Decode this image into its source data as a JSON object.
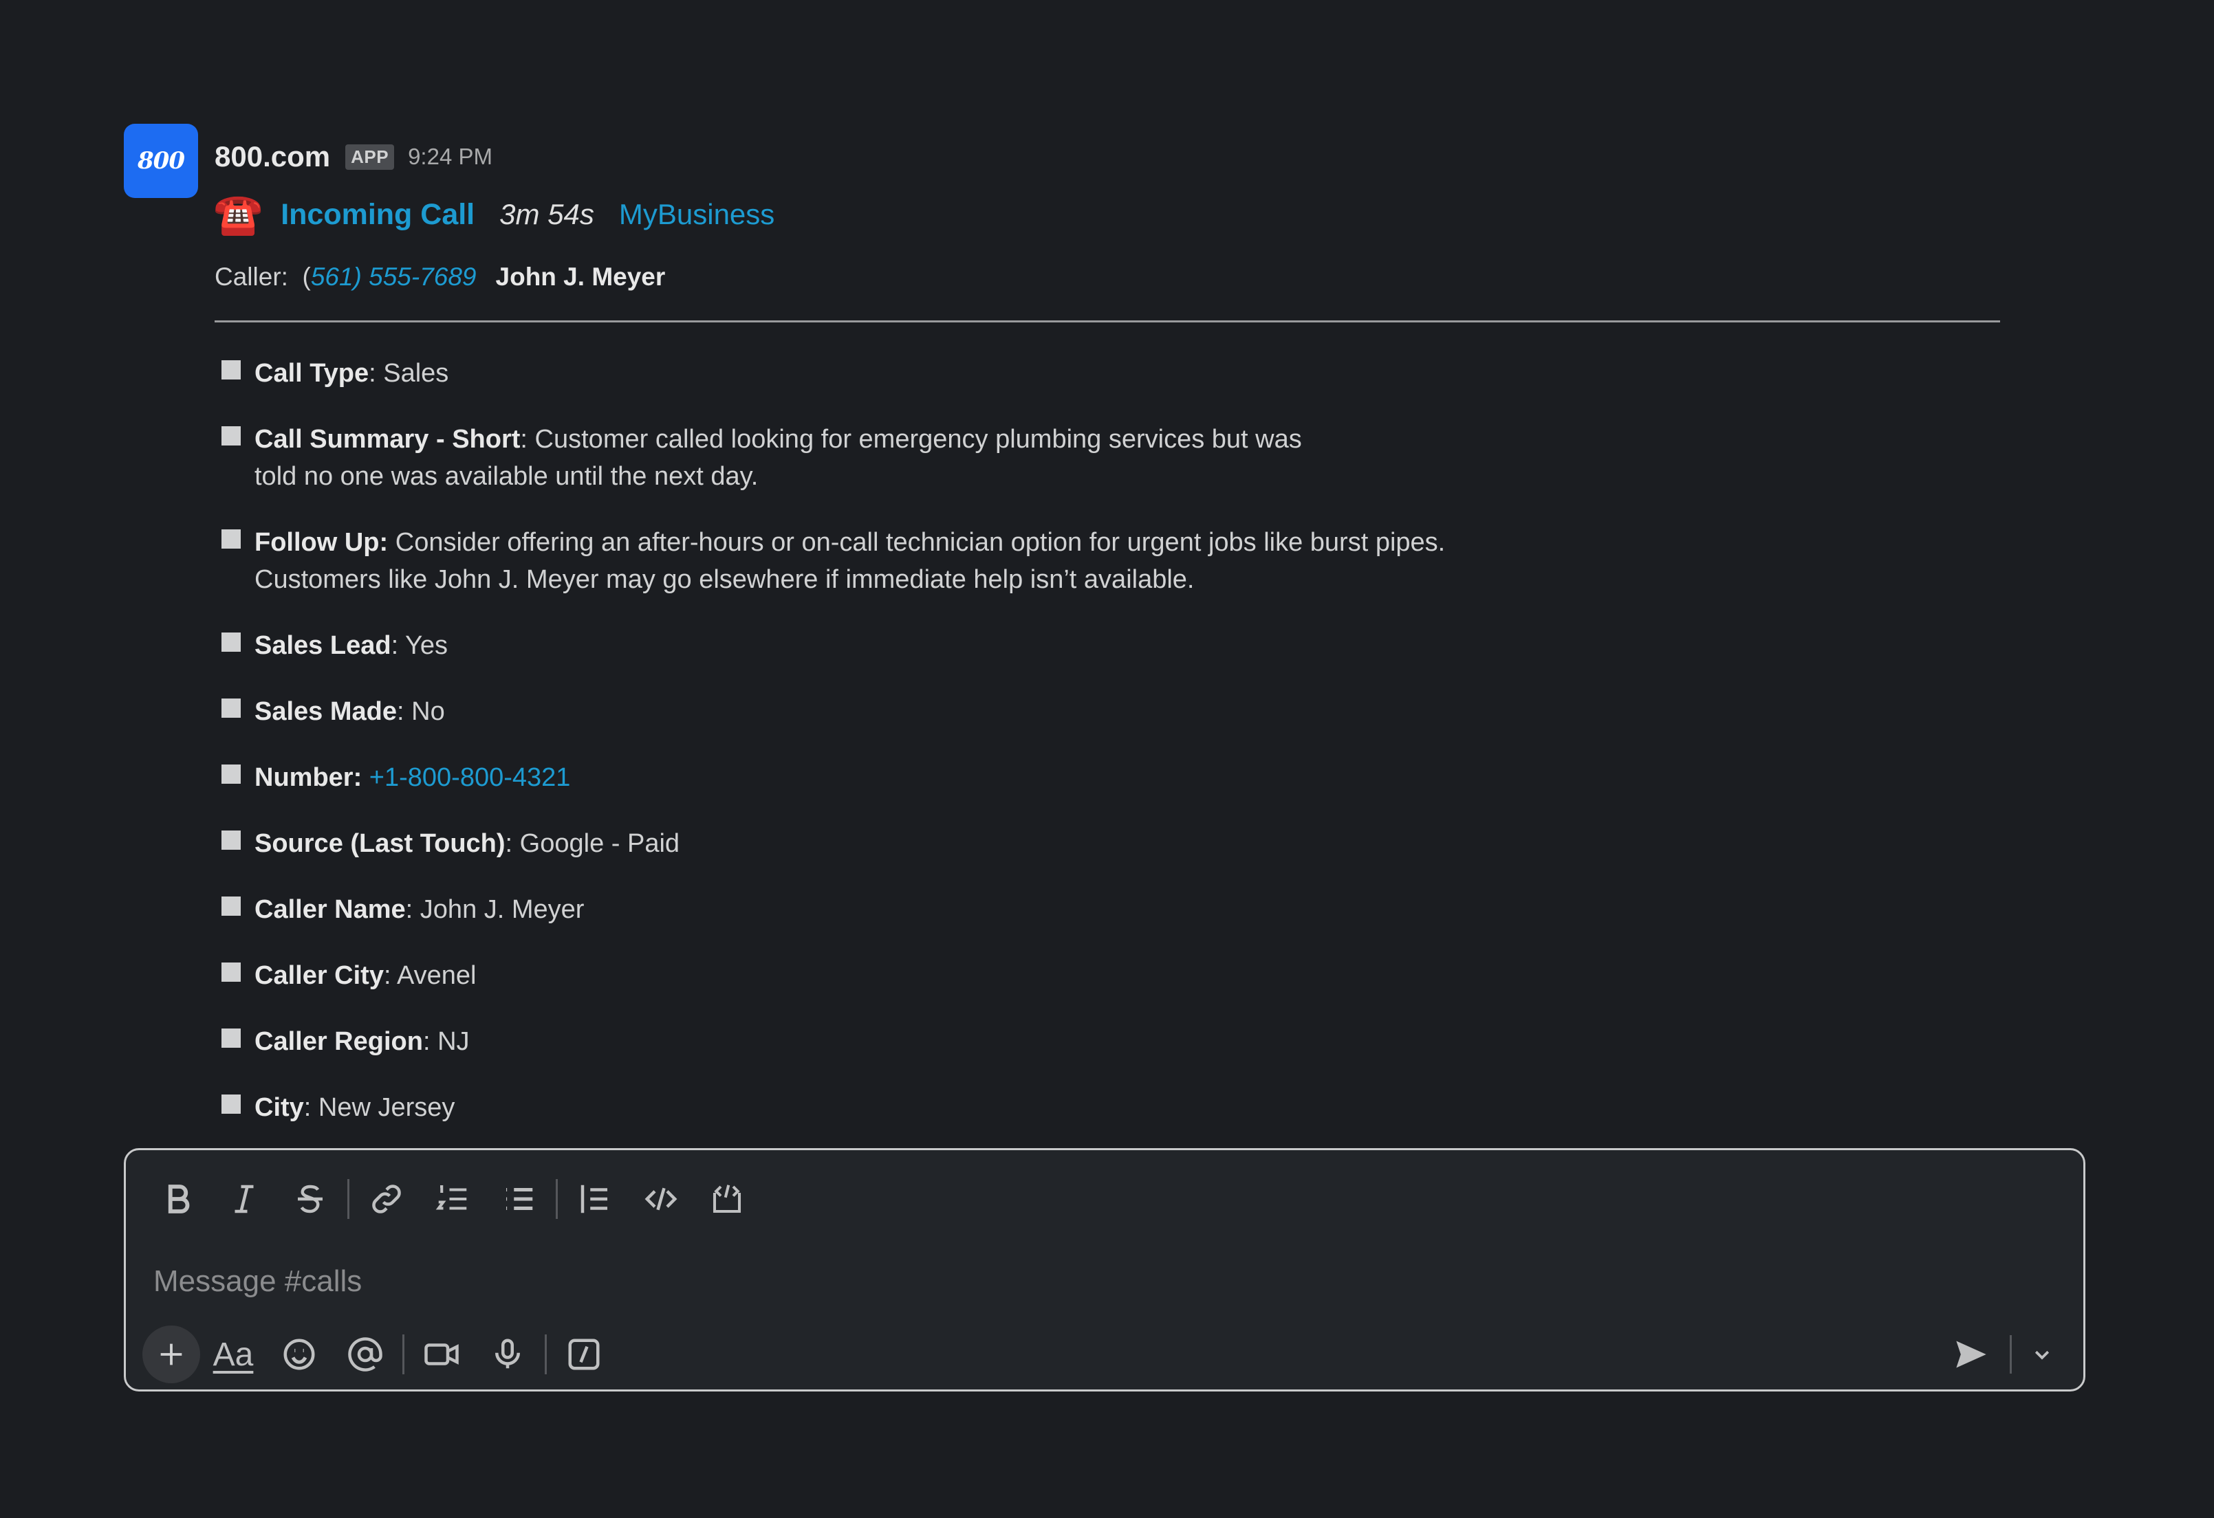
{
  "message": {
    "app_name": "800.com",
    "avatar_text": "800",
    "badge": "APP",
    "time": "9:24 PM",
    "call_icon": "telephone-emoji",
    "call_label": "Incoming Call",
    "duration": "3m 54s",
    "business": "MyBusiness",
    "caller_prefix": "Caller:",
    "caller_open_paren": "(",
    "caller_number": "561) 555-7689",
    "caller_name": "John J. Meyer",
    "fields": [
      {
        "label": "Call Type",
        "sep": ": ",
        "value": "Sales"
      },
      {
        "label": "Call Summary - Short",
        "sep": ": ",
        "value": "Customer called looking for emergency plumbing services but was",
        "value2": "told no one was available until the next day."
      },
      {
        "label": "Follow Up:",
        "sep": " ",
        "value": "Consider offering an after-hours or on-call technician option for urgent jobs like burst pipes.",
        "value2": "Customers like John J. Meyer may go elsewhere if immediate help isn’t available."
      },
      {
        "label": "Sales Lead",
        "sep": ": ",
        "value": "Yes"
      },
      {
        "label": "Sales Made",
        "sep": ": ",
        "value": "No"
      },
      {
        "label": "Number:",
        "sep": " ",
        "link": "+1-800-800-4321"
      },
      {
        "label": "Source (Last Touch)",
        "sep": ": ",
        "value": "Google - Paid"
      },
      {
        "label": "Caller Name",
        "sep": ": ",
        "value": "John J. Meyer"
      },
      {
        "label": "Caller City",
        "sep": ": ",
        "value": "Avenel"
      },
      {
        "label": "Caller Region",
        "sep": ": ",
        "value": "NJ"
      },
      {
        "label": "City",
        "sep": ": ",
        "value": "New Jersey"
      }
    ]
  },
  "composer": {
    "placeholder": "Message #calls",
    "format_aa": "Aa",
    "top_tools": [
      "bold-icon",
      "italic-icon",
      "strikethrough-icon",
      "link-icon",
      "ordered-list-icon",
      "bullet-list-icon",
      "blockquote-icon",
      "code-icon",
      "code-block-icon"
    ],
    "bottom_tools": [
      "plus-icon",
      "formatting-icon",
      "emoji-icon",
      "mention-icon",
      "video-icon",
      "microphone-icon",
      "slash-command-icon",
      "send-icon",
      "chevron-down-icon"
    ]
  },
  "colors": {
    "background": "#1b1d21",
    "link": "#1d9bd1",
    "avatar": "#1d6cf2"
  }
}
